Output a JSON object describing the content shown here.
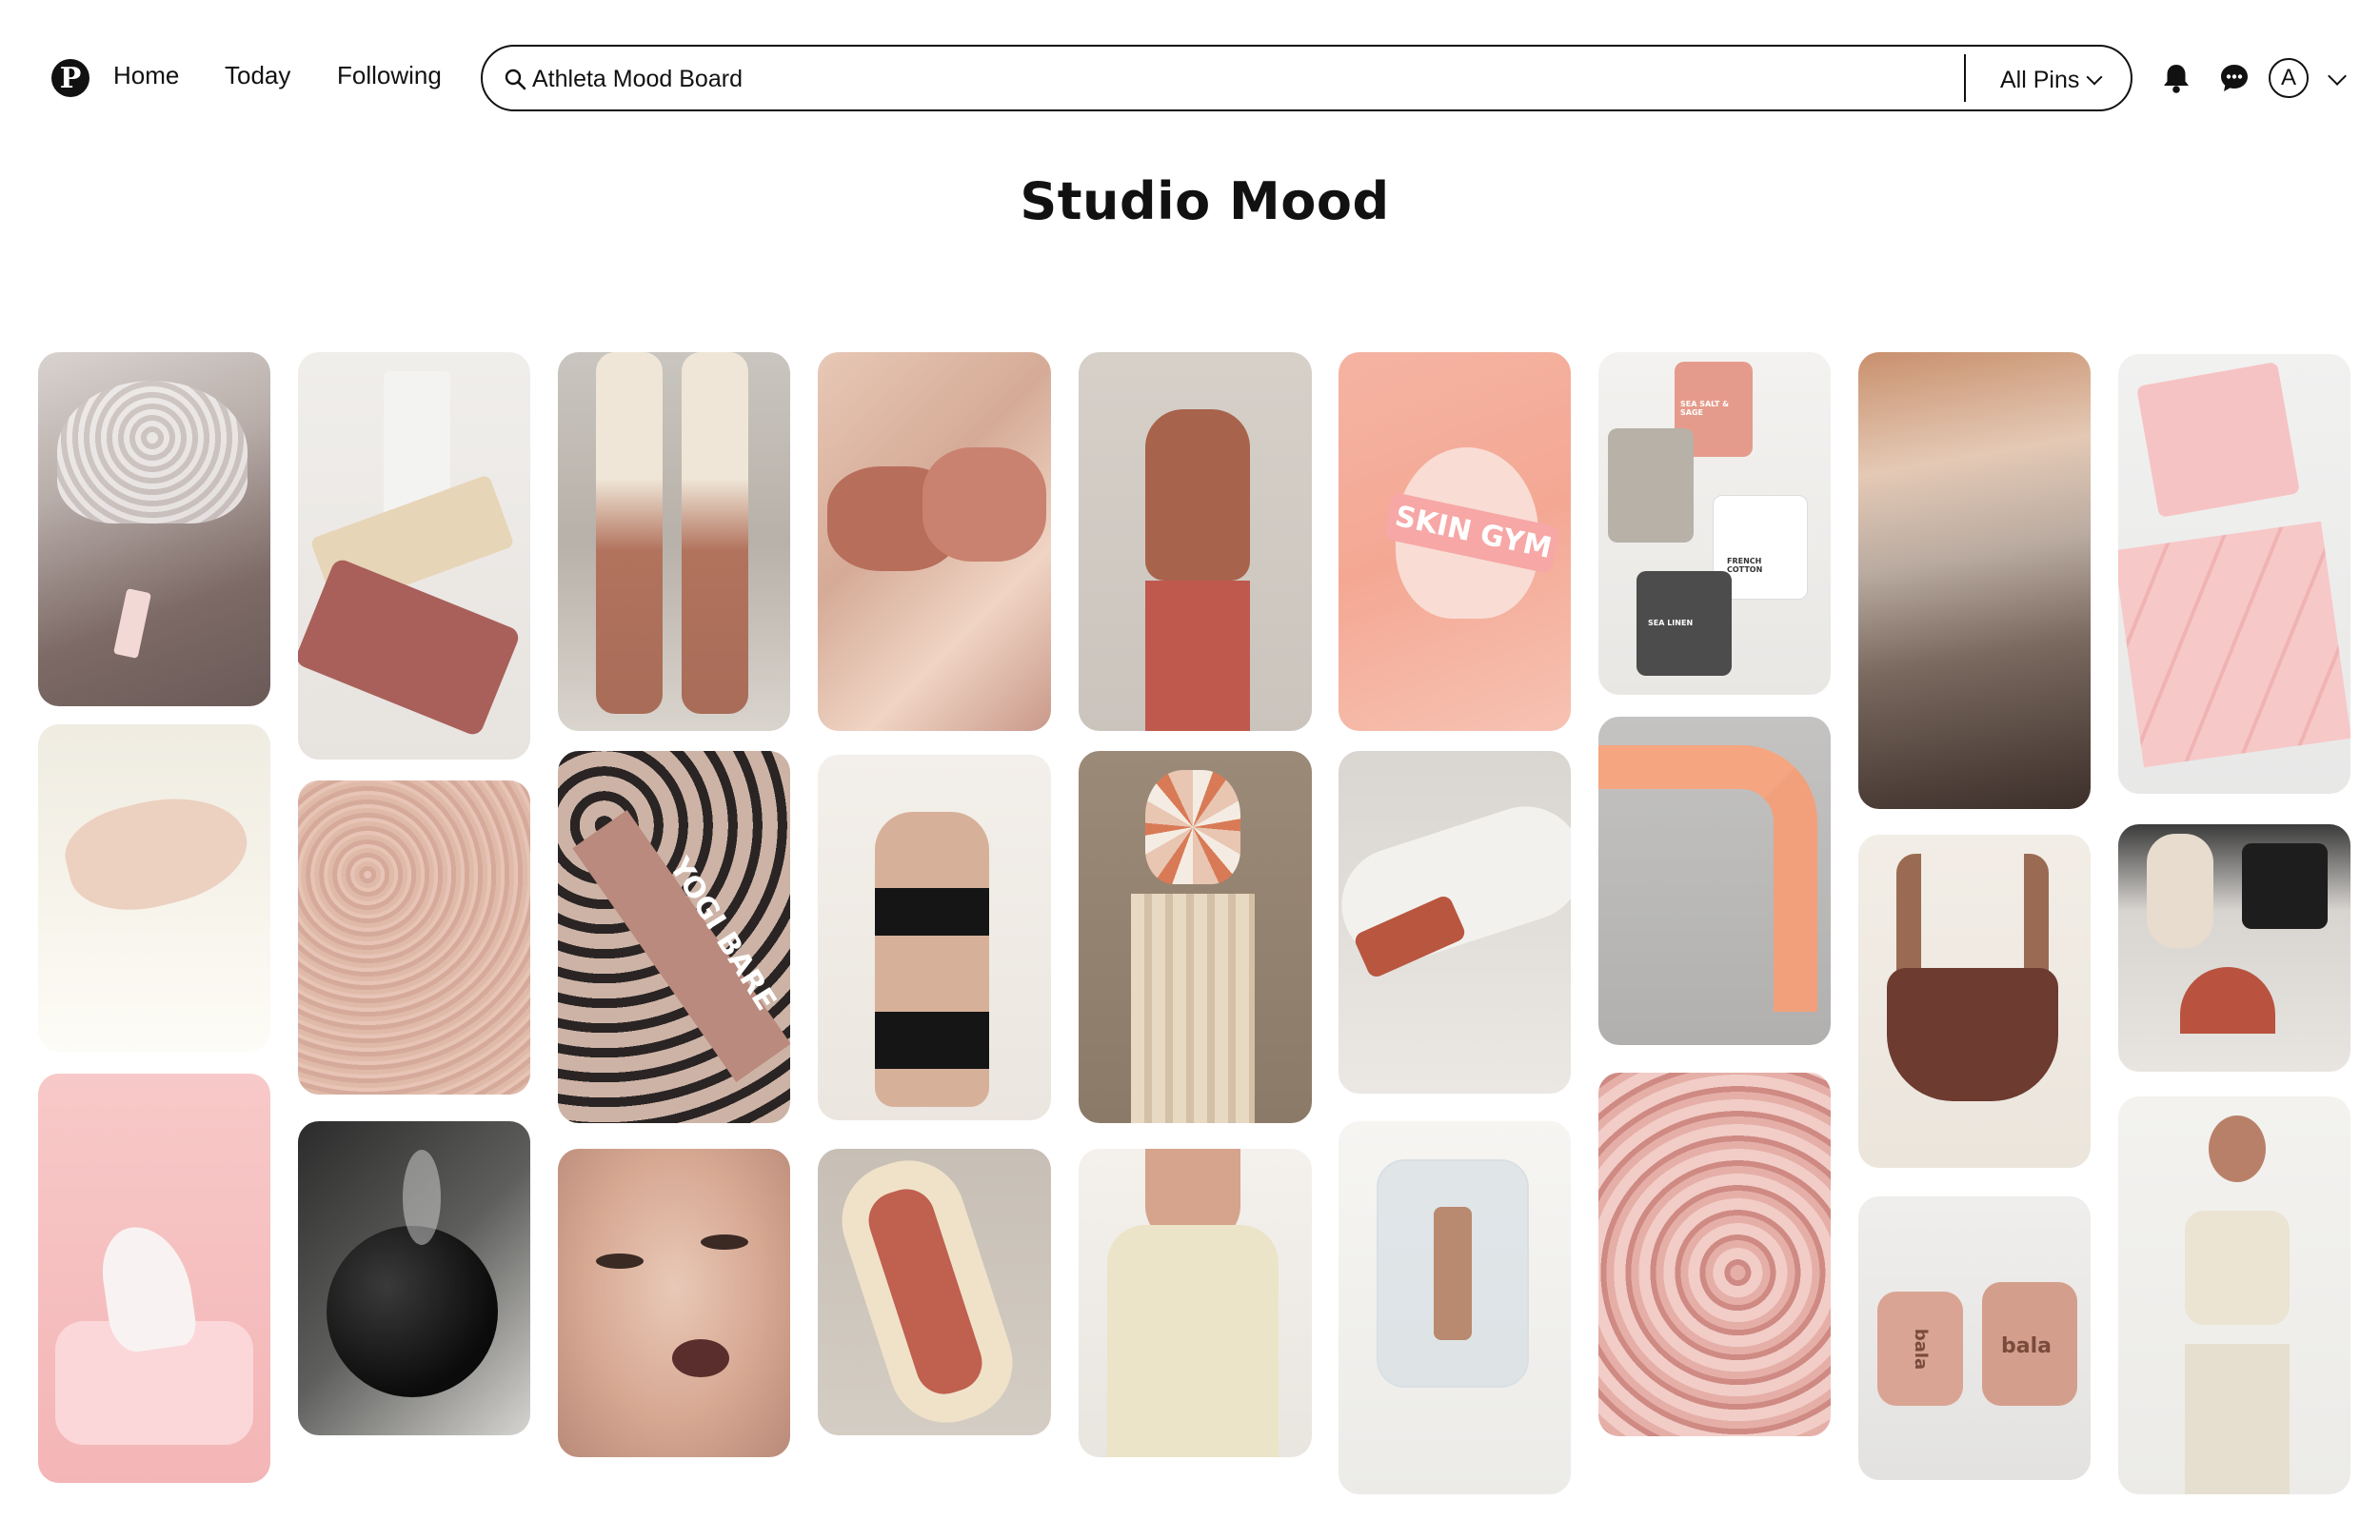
{
  "header": {
    "logo_glyph": "P",
    "nav": {
      "home": "Home",
      "today": "Today",
      "following": "Following"
    },
    "search": {
      "value": "Athleta Mood Board",
      "placeholder": "Search"
    },
    "filter_label": "All Pins",
    "avatar_initial": "A"
  },
  "board": {
    "title": "Studio Mood"
  },
  "pin_text": {
    "skin_gym": "SKIN GYM",
    "yogi_bare": "YOGI BARE",
    "bala_1": "bala",
    "bala_2": "bala",
    "candle_1": "SEA SALT & SAGE",
    "candle_2": "FRENCH COTTON",
    "candle_3": "SEA LINEN"
  }
}
